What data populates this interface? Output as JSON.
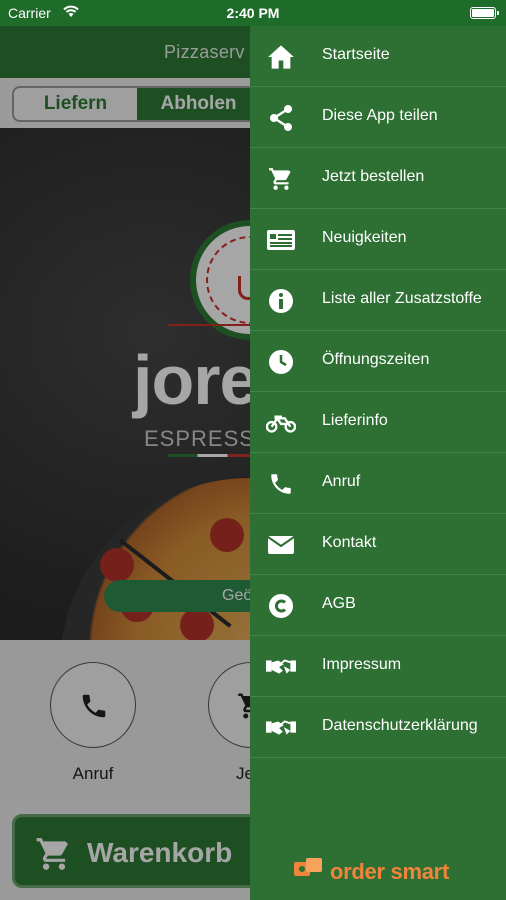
{
  "status_bar": {
    "carrier": "Carrier",
    "time": "2:40 PM"
  },
  "header": {
    "title": "Pizzaserv"
  },
  "order_mode": {
    "deliver": "Liefern",
    "pickup": "Abholen"
  },
  "hero": {
    "brand": "jore",
    "subtitle": "ESPRESSO",
    "open_status": "Geö"
  },
  "actions": [
    {
      "label": "Anruf",
      "icon": "phone-icon"
    },
    {
      "label": "Jetzt b",
      "icon": "cart-icon"
    }
  ],
  "cart": {
    "label": "Warenkorb"
  },
  "drawer": {
    "items": [
      {
        "label": "Startseite",
        "icon": "home-icon"
      },
      {
        "label": "Diese App teilen",
        "icon": "share-icon"
      },
      {
        "label": "Jetzt bestellen",
        "icon": "cart-icon"
      },
      {
        "label": "Neuigkeiten",
        "icon": "news-icon"
      },
      {
        "label": "Liste aller Zusatzstoffe",
        "icon": "info-icon"
      },
      {
        "label": "Öffnungszeiten",
        "icon": "clock-icon"
      },
      {
        "label": "Lieferinfo",
        "icon": "motorcycle-icon"
      },
      {
        "label": "Anruf",
        "icon": "phone-icon"
      },
      {
        "label": "Kontakt",
        "icon": "mail-icon"
      },
      {
        "label": "AGB",
        "icon": "copyright-icon"
      },
      {
        "label": "Impressum",
        "icon": "handshake-icon"
      },
      {
        "label": "Datenschutzerklärung",
        "icon": "handshake-icon"
      }
    ],
    "footer_brand": "order smart"
  },
  "colors": {
    "primary": "#2f7a37",
    "drawer": "#2e6f33",
    "accent": "#f0843c",
    "status_bar": "#1f6b2a"
  }
}
